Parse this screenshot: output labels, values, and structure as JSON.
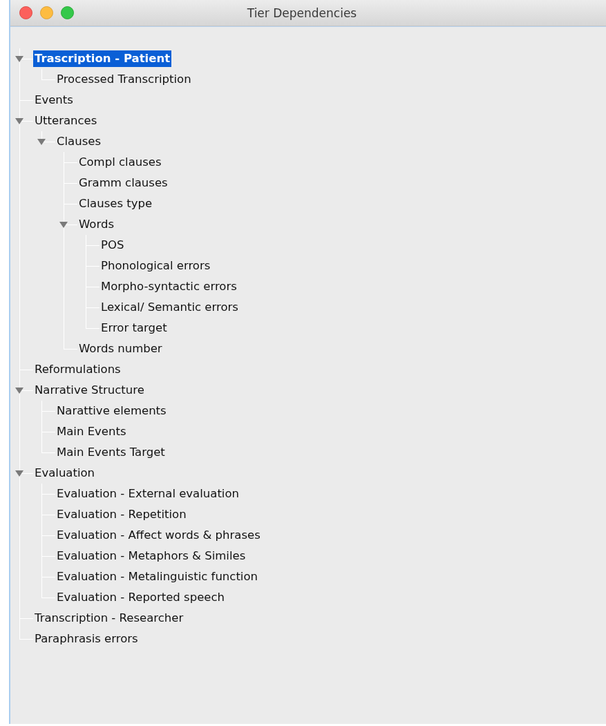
{
  "window": {
    "title": "Tier Dependencies"
  },
  "tree": [
    {
      "label": "Trascription - Patient",
      "selected": true,
      "expanded": true,
      "children": [
        {
          "label": "Processed Transcription",
          "selected": false
        }
      ]
    },
    {
      "label": "Events",
      "selected": false
    },
    {
      "label": "Utterances",
      "selected": false,
      "expanded": true,
      "children": [
        {
          "label": "Clauses",
          "selected": false,
          "expanded": true,
          "children": [
            {
              "label": "Compl clauses",
              "selected": false
            },
            {
              "label": "Gramm clauses",
              "selected": false
            },
            {
              "label": "Clauses type",
              "selected": false
            },
            {
              "label": "Words",
              "selected": false,
              "expanded": true,
              "children": [
                {
                  "label": "POS",
                  "selected": false
                },
                {
                  "label": "Phonological errors",
                  "selected": false
                },
                {
                  "label": "Morpho-syntactic errors",
                  "selected": false
                },
                {
                  "label": "Lexical/ Semantic errors",
                  "selected": false
                },
                {
                  "label": "Error target",
                  "selected": false
                }
              ]
            },
            {
              "label": "Words number",
              "selected": false
            }
          ]
        }
      ]
    },
    {
      "label": "Reformulations",
      "selected": false
    },
    {
      "label": "Narrative Structure",
      "selected": false,
      "expanded": true,
      "children": [
        {
          "label": "Narattive elements",
          "selected": false
        },
        {
          "label": "Main Events",
          "selected": false
        },
        {
          "label": "Main Events Target",
          "selected": false
        }
      ]
    },
    {
      "label": "Evaluation",
      "selected": false,
      "expanded": true,
      "children": [
        {
          "label": "Evaluation - External evaluation",
          "selected": false
        },
        {
          "label": "Evaluation - Repetition",
          "selected": false
        },
        {
          "label": "Evaluation - Affect words & phrases",
          "selected": false
        },
        {
          "label": "Evaluation - Metaphors & Similes",
          "selected": false
        },
        {
          "label": "Evaluation - Metalinguistic function",
          "selected": false
        },
        {
          "label": "Evaluation - Reported speech",
          "selected": false
        }
      ]
    },
    {
      "label": "Transcription - Researcher",
      "selected": false
    },
    {
      "label": "Paraphrasis errors",
      "selected": false
    }
  ]
}
